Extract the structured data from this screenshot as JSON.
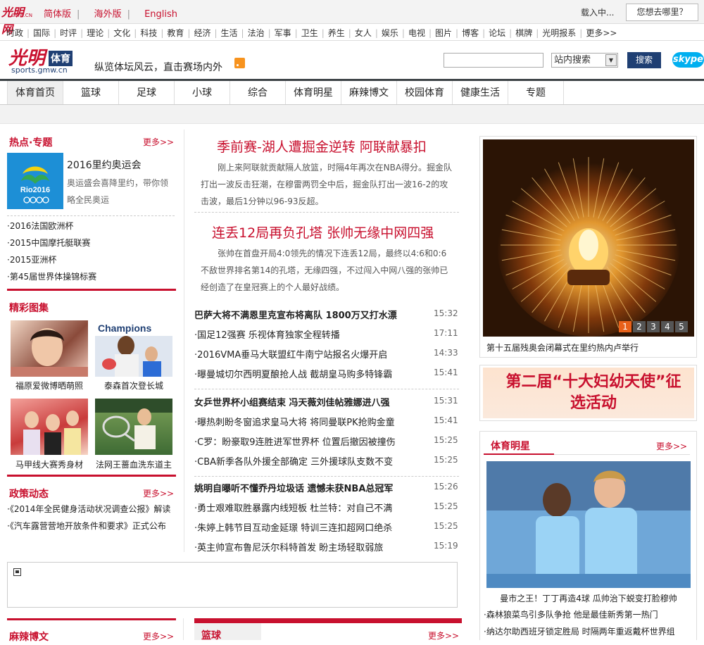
{
  "topbar": {
    "logo_text": "光明网",
    "logo_sub": "GMW.CN",
    "links": [
      "简体版",
      "海外版",
      "English"
    ],
    "loading": "载入中...",
    "where_button": "您想去哪里？"
  },
  "channel_nav": [
    "时政",
    "国际",
    "时评",
    "理论",
    "文化",
    "科技",
    "教育",
    "经济",
    "生活",
    "法治",
    "军事",
    "卫生",
    "养生",
    "女人",
    "娱乐",
    "电视",
    "图片",
    "博客",
    "论坛",
    "棋牌",
    "光明报系",
    "更多>>"
  ],
  "header": {
    "logo_guang": "光明",
    "logo_tiyu": "体育",
    "logo_url": "sports.gmw.cn",
    "slogan": "纵览体坛风云，直击赛场内外",
    "search_placeholder": "",
    "search_option": "站内搜索",
    "search_button": "搜索",
    "skype": "skype"
  },
  "main_nav": [
    "体育首页",
    "篮球",
    "足球",
    "小球",
    "综合",
    "体育明星",
    "麻辣博文",
    "校园体育",
    "健康生活",
    "专题"
  ],
  "left": {
    "hot": {
      "title": "热点·专题",
      "more": "更多>>",
      "feature_title": "2016里约奥运会",
      "feature_desc": "奥运盛会喜降里约，带你领略全民奥运",
      "feature_logo": "Rio2016",
      "links": [
        "·2016法国欧洲杯",
        "·2015中国摩托艇联赛",
        "·2015亚洲杯",
        "·第45届世界体操锦标赛"
      ]
    },
    "gallery": {
      "title": "精彩图集",
      "items": [
        "福原爱微博晒萌照",
        "泰森首次登长城",
        "马甲线大赛秀身材",
        "法网王蔷血洗东道主"
      ],
      "banner_text": "Champions"
    },
    "policy": {
      "title": "政策动态",
      "more": "更多>>",
      "links": [
        "·《2014年全民健身活动状况调查公报》解读",
        "·《汽车露营营地开放条件和要求》正式公布"
      ]
    },
    "blog": {
      "title": "麻辣博文",
      "more": "更多>>"
    }
  },
  "center": {
    "headlines": [
      {
        "title": "季前赛-湖人遭掘金逆转 阿联献暴扣",
        "summary": "刚上来阿联就贡献隔人放篮，时隔4年再次在NBA得分。掘金队打出一波反击狂潮，在穆雷两罚全中后，掘金队打出一波16-2的攻击波，最后1分钟以96-93反超。"
      },
      {
        "title": "连丢12局再负孔塔 张帅无缘中网四强",
        "summary": "张帅在首盘开局4:0领先的情况下连丢12局，最终以4:6和0:6不敌世界排名第14的孔塔，无缘四强，不过闯入中网八强的张帅已经创造了在皇冠赛上的个人最好战绩。"
      }
    ],
    "news_groups": [
      [
        {
          "title": "巴萨大将不满恩里克宣布将离队 1800万又打水漂",
          "time": "15:32",
          "bold": true
        },
        {
          "title": "·国足12强赛 乐视体育独家全程转播",
          "time": "17:11",
          "bold": false
        },
        {
          "title": "·2016VMA垂马大联盟红牛南宁站报名火爆开启",
          "time": "14:33",
          "bold": false
        },
        {
          "title": "·曝曼城切尔西明夏酿抢人战 截胡皇马购多特锋霸",
          "time": "15:41",
          "bold": false
        }
      ],
      [
        {
          "title": "女乒世界杯小组赛结束 冯天薇刘佳帖雅娜进八强",
          "time": "15:31",
          "bold": true
        },
        {
          "title": "·曝热刺盼冬窗追求皇马大将 将同曼联PK抢购金童",
          "time": "15:41",
          "bold": false
        },
        {
          "title": "·C罗：盼豪取9连胜进军世界杯 位置后撤因被撞伤",
          "time": "15:25",
          "bold": false
        },
        {
          "title": "·CBA新季各队外援全部确定 三外援球队支数不变",
          "time": "15:25",
          "bold": false
        }
      ],
      [
        {
          "title": "姚明自曝听不懂乔丹垃圾话 遗憾未获NBA总冠军",
          "time": "15:26",
          "bold": true
        },
        {
          "title": "·勇士艰难取胜暴露内线短板 杜兰特：对自己不满",
          "time": "15:25",
          "bold": false
        },
        {
          "title": "·朱婷上韩节目互动金延璟 特训三连扣超网口绝杀",
          "time": "15:25",
          "bold": false
        },
        {
          "title": "·英主帅宣布鲁尼沃尔科特首发 盼主场轻取弱旅",
          "time": "15:19",
          "bold": false
        }
      ]
    ],
    "basketball": {
      "title": "篮球",
      "more": "更多>>"
    }
  },
  "right": {
    "slider": {
      "caption": "第十五届残奥会闭幕式在里约热内卢举行",
      "pages": [
        "1",
        "2",
        "3",
        "4",
        "5"
      ],
      "active": 0
    },
    "banner": "第二届“十大妇幼天使”征选活动",
    "star": {
      "title": "体育明星",
      "more": "更多>>",
      "caption": "曼市之王！丁丁再造4球 瓜帅治下蜕变打脸穆帅",
      "links": [
        "·森林狼菜鸟引多队争抢 他是最佳新秀第一热门",
        "·纳达尔助西班牙锁定胜局 时隔两年重返戴杯世界组"
      ]
    }
  },
  "colors": {
    "brand_red": "#c8102e",
    "navy": "#1f3f73",
    "nav_dark": "#3d4347"
  }
}
